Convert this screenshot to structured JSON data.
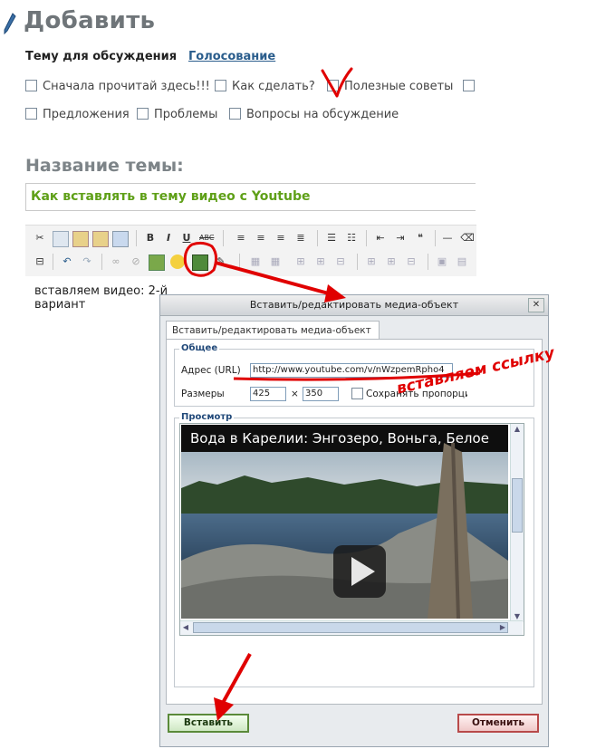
{
  "page": {
    "title": "Добавить",
    "tabs": [
      "Тему для обсуждения",
      "Голосование"
    ],
    "categories": [
      "Сначала прочитай здесь!!!",
      "Как сделать?",
      "Полезные советы",
      "",
      "Предложения",
      "Проблемы",
      "Вопросы на обсуждение"
    ],
    "topic_label": "Название темы:",
    "topic_value": "Как вставлять в тему видео с Youtube",
    "editor_text": "вставляем видео: 2-й вариант"
  },
  "toolbar": {
    "row1": [
      "cut-icon",
      "copy-icon",
      "paste-icon",
      "paste-text-icon",
      "paste-word-icon",
      "bold-icon",
      "italic-icon",
      "underline-icon",
      "strikethrough-icon",
      "align-left-icon",
      "align-center-icon",
      "align-right-icon",
      "align-justify-icon",
      "bullet-list-icon",
      "numbered-list-icon",
      "outdent-icon",
      "indent-icon",
      "undo-icon",
      "redo-icon",
      "horizontal-rule-icon",
      "eraser-icon"
    ],
    "row2": [
      "hr-icon",
      "undo-icon",
      "redo-icon",
      "link-icon",
      "unlink-icon",
      "image-icon",
      "emoticon-icon",
      "media-icon",
      "edit-icon",
      "table-icon"
    ]
  },
  "dialog": {
    "title": "Вставить/редактировать медиа-объект",
    "close": "✕",
    "tab": "Вставить/редактировать медиа-объект",
    "general_legend": "Общее",
    "url_label": "Адрес (URL)",
    "url_value": "http://www.youtube.com/v/nWzpemRpho4",
    "size_label": "Размеры",
    "width": "425",
    "height": "350",
    "times": "×",
    "keep_ratio": "Сохранять пропорции",
    "preview_legend": "Просмотр",
    "video_title": "Вода в Карелии: Энгозеро, Воньга, Белое",
    "insert_button": "Вставить",
    "cancel_button": "Отменить"
  },
  "annotation": {
    "handwritten": "вставляем ссылку",
    "check_mark": "V"
  },
  "colors": {
    "annotation": "#e00000",
    "topic_text": "#5fa018",
    "link": "#2a5d8c"
  }
}
